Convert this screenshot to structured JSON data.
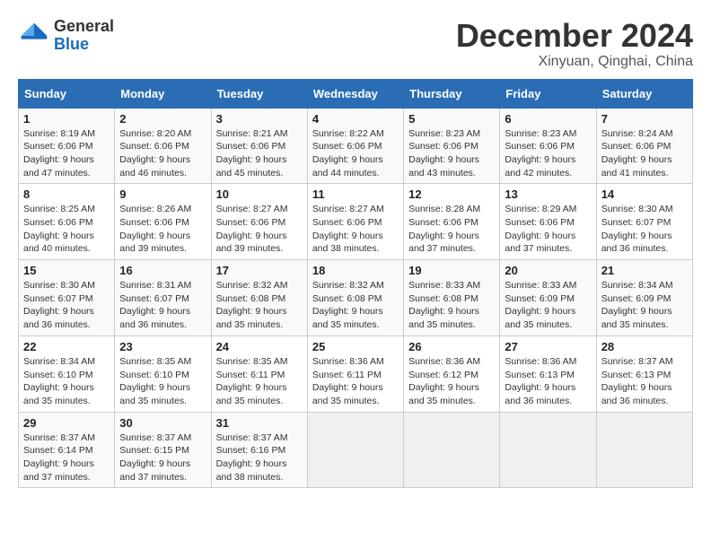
{
  "header": {
    "logo_line1": "General",
    "logo_line2": "Blue",
    "month": "December 2024",
    "location": "Xinyuan, Qinghai, China"
  },
  "weekdays": [
    "Sunday",
    "Monday",
    "Tuesday",
    "Wednesday",
    "Thursday",
    "Friday",
    "Saturday"
  ],
  "weeks": [
    [
      {
        "day": "1",
        "sunrise": "8:19 AM",
        "sunset": "6:06 PM",
        "daylight": "9 hours and 47 minutes."
      },
      {
        "day": "2",
        "sunrise": "8:20 AM",
        "sunset": "6:06 PM",
        "daylight": "9 hours and 46 minutes."
      },
      {
        "day": "3",
        "sunrise": "8:21 AM",
        "sunset": "6:06 PM",
        "daylight": "9 hours and 45 minutes."
      },
      {
        "day": "4",
        "sunrise": "8:22 AM",
        "sunset": "6:06 PM",
        "daylight": "9 hours and 44 minutes."
      },
      {
        "day": "5",
        "sunrise": "8:23 AM",
        "sunset": "6:06 PM",
        "daylight": "9 hours and 43 minutes."
      },
      {
        "day": "6",
        "sunrise": "8:23 AM",
        "sunset": "6:06 PM",
        "daylight": "9 hours and 42 minutes."
      },
      {
        "day": "7",
        "sunrise": "8:24 AM",
        "sunset": "6:06 PM",
        "daylight": "9 hours and 41 minutes."
      }
    ],
    [
      {
        "day": "8",
        "sunrise": "8:25 AM",
        "sunset": "6:06 PM",
        "daylight": "9 hours and 40 minutes."
      },
      {
        "day": "9",
        "sunrise": "8:26 AM",
        "sunset": "6:06 PM",
        "daylight": "9 hours and 39 minutes."
      },
      {
        "day": "10",
        "sunrise": "8:27 AM",
        "sunset": "6:06 PM",
        "daylight": "9 hours and 39 minutes."
      },
      {
        "day": "11",
        "sunrise": "8:27 AM",
        "sunset": "6:06 PM",
        "daylight": "9 hours and 38 minutes."
      },
      {
        "day": "12",
        "sunrise": "8:28 AM",
        "sunset": "6:06 PM",
        "daylight": "9 hours and 37 minutes."
      },
      {
        "day": "13",
        "sunrise": "8:29 AM",
        "sunset": "6:06 PM",
        "daylight": "9 hours and 37 minutes."
      },
      {
        "day": "14",
        "sunrise": "8:30 AM",
        "sunset": "6:07 PM",
        "daylight": "9 hours and 36 minutes."
      }
    ],
    [
      {
        "day": "15",
        "sunrise": "8:30 AM",
        "sunset": "6:07 PM",
        "daylight": "9 hours and 36 minutes."
      },
      {
        "day": "16",
        "sunrise": "8:31 AM",
        "sunset": "6:07 PM",
        "daylight": "9 hours and 36 minutes."
      },
      {
        "day": "17",
        "sunrise": "8:32 AM",
        "sunset": "6:08 PM",
        "daylight": "9 hours and 35 minutes."
      },
      {
        "day": "18",
        "sunrise": "8:32 AM",
        "sunset": "6:08 PM",
        "daylight": "9 hours and 35 minutes."
      },
      {
        "day": "19",
        "sunrise": "8:33 AM",
        "sunset": "6:08 PM",
        "daylight": "9 hours and 35 minutes."
      },
      {
        "day": "20",
        "sunrise": "8:33 AM",
        "sunset": "6:09 PM",
        "daylight": "9 hours and 35 minutes."
      },
      {
        "day": "21",
        "sunrise": "8:34 AM",
        "sunset": "6:09 PM",
        "daylight": "9 hours and 35 minutes."
      }
    ],
    [
      {
        "day": "22",
        "sunrise": "8:34 AM",
        "sunset": "6:10 PM",
        "daylight": "9 hours and 35 minutes."
      },
      {
        "day": "23",
        "sunrise": "8:35 AM",
        "sunset": "6:10 PM",
        "daylight": "9 hours and 35 minutes."
      },
      {
        "day": "24",
        "sunrise": "8:35 AM",
        "sunset": "6:11 PM",
        "daylight": "9 hours and 35 minutes."
      },
      {
        "day": "25",
        "sunrise": "8:36 AM",
        "sunset": "6:11 PM",
        "daylight": "9 hours and 35 minutes."
      },
      {
        "day": "26",
        "sunrise": "8:36 AM",
        "sunset": "6:12 PM",
        "daylight": "9 hours and 35 minutes."
      },
      {
        "day": "27",
        "sunrise": "8:36 AM",
        "sunset": "6:13 PM",
        "daylight": "9 hours and 36 minutes."
      },
      {
        "day": "28",
        "sunrise": "8:37 AM",
        "sunset": "6:13 PM",
        "daylight": "9 hours and 36 minutes."
      }
    ],
    [
      {
        "day": "29",
        "sunrise": "8:37 AM",
        "sunset": "6:14 PM",
        "daylight": "9 hours and 37 minutes."
      },
      {
        "day": "30",
        "sunrise": "8:37 AM",
        "sunset": "6:15 PM",
        "daylight": "9 hours and 37 minutes."
      },
      {
        "day": "31",
        "sunrise": "8:37 AM",
        "sunset": "6:16 PM",
        "daylight": "9 hours and 38 minutes."
      },
      null,
      null,
      null,
      null
    ]
  ]
}
